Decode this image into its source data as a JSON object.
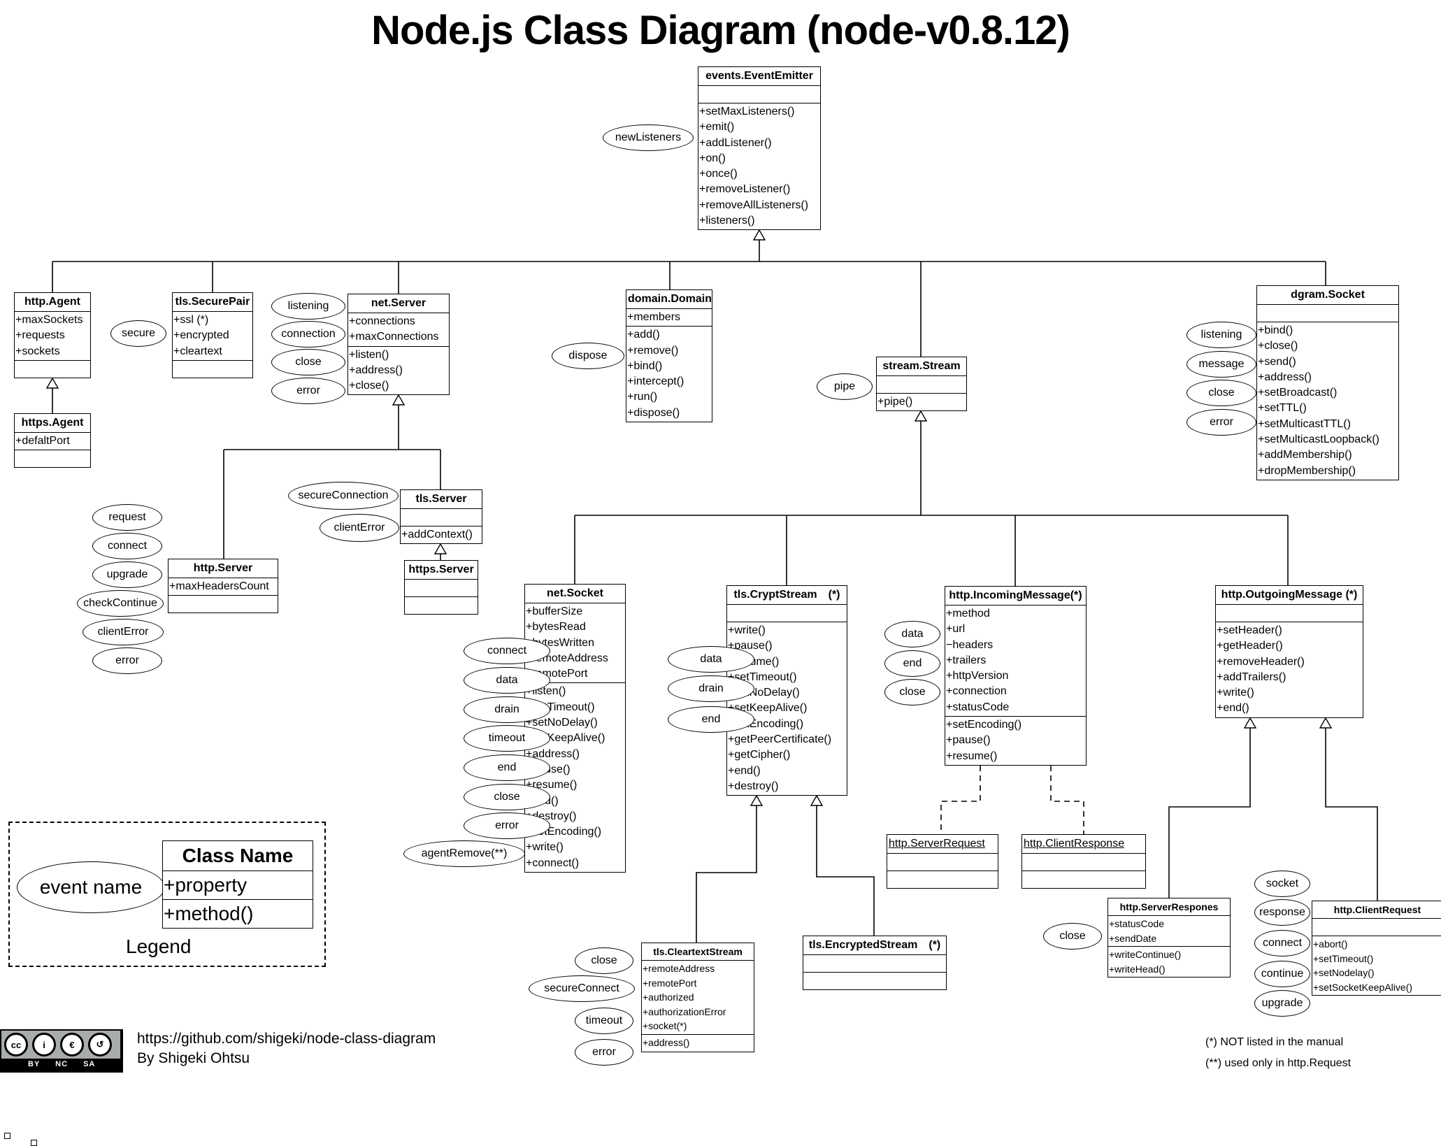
{
  "title": "Node.js Class Diagram (node-v0.8.12)",
  "classes": {
    "EventEmitter": {
      "name": "events.EventEmitter",
      "props": [],
      "methods": [
        "+setMaxListeners()",
        "+emit()",
        "+addListener()",
        "+on()",
        "+once()",
        "+removeListener()",
        "+removeAllListeners()",
        "+listeners()"
      ],
      "events": [
        "newListeners"
      ]
    },
    "HttpAgent": {
      "name": "http.Agent",
      "props": [
        "+maxSockets",
        "+requests",
        "+sockets"
      ],
      "methods": []
    },
    "HttpsAgent": {
      "name": "https.Agent",
      "props": [
        "+defaltPort"
      ],
      "methods": []
    },
    "SecurePair": {
      "name": "tls.SecurePair",
      "props": [
        "+ssl (*)",
        "+encrypted",
        "+cleartext"
      ],
      "methods": [],
      "events": [
        "secure"
      ]
    },
    "NetServer": {
      "name": "net.Server",
      "props": [
        "+connections",
        "+maxConnections"
      ],
      "methods": [
        "+listen()",
        "+address()",
        "+close()"
      ],
      "events": [
        "listening",
        "connection",
        "close",
        "error"
      ]
    },
    "Domain": {
      "name": "domain.Domain",
      "props": [
        "+members"
      ],
      "methods": [
        "+add()",
        "+remove()",
        "+bind()",
        "+intercept()",
        "+run()",
        "+dispose()"
      ],
      "events": [
        "dispose"
      ]
    },
    "Stream": {
      "name": "stream.Stream",
      "props": [],
      "methods": [
        "+pipe()"
      ],
      "events": [
        "pipe"
      ]
    },
    "DgramSocket": {
      "name": "dgram.Socket",
      "props": [],
      "methods": [
        "+bind()",
        "+close()",
        "+send()",
        "+address()",
        "+setBroadcast()",
        "+setTTL()",
        "+setMulticastTTL()",
        "+setMulticastLoopback()",
        "+addMembership()",
        "+dropMembership()"
      ],
      "events": [
        "listening",
        "message",
        "close",
        "error"
      ]
    },
    "HttpServer": {
      "name": "http.Server",
      "props": [
        "+maxHeadersCount"
      ],
      "methods": [],
      "events": [
        "request",
        "connect",
        "upgrade",
        "checkContinue",
        "clientError",
        "error"
      ]
    },
    "TlsServer": {
      "name": "tls.Server",
      "props": [],
      "methods": [
        "+addContext()"
      ],
      "events": [
        "secureConnection",
        "clientError"
      ]
    },
    "HttpsServer": {
      "name": "https.Server",
      "props": [],
      "methods": []
    },
    "NetSocket": {
      "name": "net.Socket",
      "props": [
        "+bufferSize",
        "+bytesRead",
        "+bytesWritten",
        "+remoteAddress",
        "+remotePort"
      ],
      "methods": [
        "+listen()",
        "+setTimeout()",
        "+setNoDelay()",
        "+setKeepAlive()",
        "+address()",
        "+pause()",
        "+resume()",
        "+end()",
        "+destroy()",
        "+setEncoding()",
        "+write()",
        "+connect()"
      ],
      "events": [
        "connect",
        "data",
        "drain",
        "timeout",
        "end",
        "close",
        "error",
        "agentRemove(**)"
      ]
    },
    "CryptStream": {
      "name": "tls.CryptStream　(*)",
      "props": [],
      "methods": [
        "+write()",
        "+pause()",
        "+resume()",
        "+setTimeout()",
        "+setNoDelay()",
        "+setKeepAlive()",
        "+setEncoding()",
        "+getPeerCertificate()",
        "+getCipher()",
        "+end()",
        "+destroy()"
      ],
      "events": [
        "data",
        "drain",
        "end"
      ]
    },
    "IncomingMessage": {
      "name": "http.IncomingMessage(*)",
      "props": [
        "+method",
        "+url",
        "−headers",
        "+trailers",
        "+httpVersion",
        "+connection",
        "+statusCode"
      ],
      "methods": [
        "+setEncoding()",
        "+pause()",
        "+resume()"
      ],
      "events": [
        "data",
        "end",
        "close"
      ]
    },
    "OutgoingMessage": {
      "name": "http.OutgoingMessage (*)",
      "props": [],
      "methods": [
        "+setHeader()",
        "+getHeader()",
        "+removeHeader()",
        "+addTrailers()",
        "+write()",
        "+end()"
      ]
    },
    "ServerRequest": {
      "name": "http.ServerRequest",
      "props": [],
      "methods": []
    },
    "ClientResponse": {
      "name": "http.ClientResponse",
      "props": [],
      "methods": []
    },
    "CleartextStream": {
      "name": "tls.CleartextStream",
      "props": [
        "+remoteAddress",
        "+remotePort",
        "+authorized",
        "+authorizationError",
        "+socket(*)"
      ],
      "methods": [
        "+address()"
      ],
      "events": [
        "close",
        "secureConnect",
        "timeout",
        "error"
      ]
    },
    "EncryptedStream": {
      "name": "tls.EncryptedStream　(*)",
      "props": [],
      "methods": []
    },
    "ServerResponse": {
      "name": "http.ServerRespones",
      "props": [
        "+statusCode",
        "+sendDate"
      ],
      "methods": [
        "+writeContinue()",
        "+writeHead()"
      ],
      "events": [
        "close"
      ]
    },
    "ClientRequest": {
      "name": "http.ClientRequest",
      "props": [],
      "methods": [
        "+abort()",
        "+setTimeout()",
        "+setNodelay()",
        "+setSocketKeepAlive()"
      ],
      "events": [
        "socket",
        "response",
        "connect",
        "continue",
        "upgrade"
      ]
    }
  },
  "legend": {
    "event": "event name",
    "class_name": "Class Name",
    "property": "+property",
    "method": "+method()",
    "title": "Legend"
  },
  "license": {
    "badge": "cc",
    "labels": "BY NC SA"
  },
  "credits": {
    "url": "https://github.com/shigeki/node-class-diagram",
    "author": "By Shigeki Ohtsu"
  },
  "notes": [
    "(*) NOT listed in the manual",
    "(**) used only in http.Request"
  ]
}
